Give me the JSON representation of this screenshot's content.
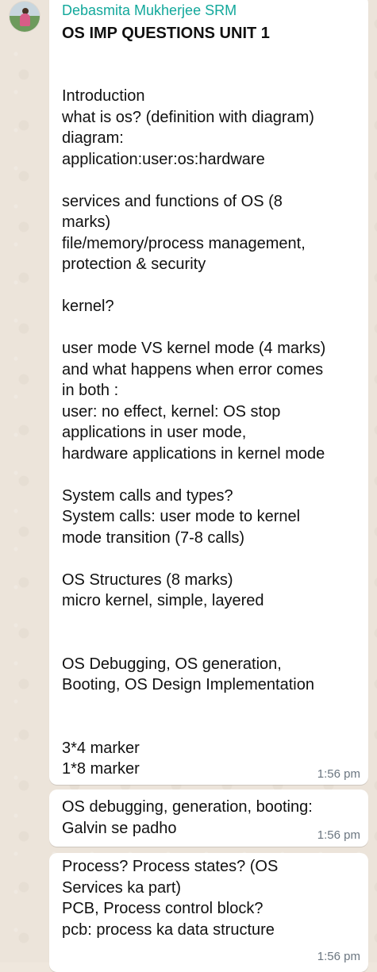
{
  "sender": "Debasmita Mukherjee SRM",
  "messages": [
    {
      "heading": "OS IMP QUESTIONS UNIT 1",
      "text": "Introduction\nwhat is os? (definition with diagram)\ndiagram:\napplication:user:os:hardware\n\nservices and functions of OS (8\nmarks)\nfile/memory/process management,\nprotection & security\n\nkernel?\n\nuser mode VS kernel mode (4 marks)\nand what happens when error comes\nin both :\nuser: no effect, kernel: OS stop\napplications in user mode,\nhardware applications in kernel mode\n\nSystem calls and types?\nSystem calls: user mode to kernel\nmode transition (7-8 calls)\n\nOS Structures (8 marks)\nmicro kernel, simple, layered\n\n\nOS Debugging, OS generation,\nBooting, OS Design Implementation\n\n\n3*4 marker\n1*8 marker",
      "time": "1:56 pm"
    },
    {
      "text": "OS debugging, generation, booting:\nGalvin se padho",
      "time": "1:56 pm"
    },
    {
      "text": "Process? Process states? (OS\nServices ka part)\nPCB, Process control block?\npcb: process ka data structure",
      "time": "1:56 pm"
    }
  ]
}
